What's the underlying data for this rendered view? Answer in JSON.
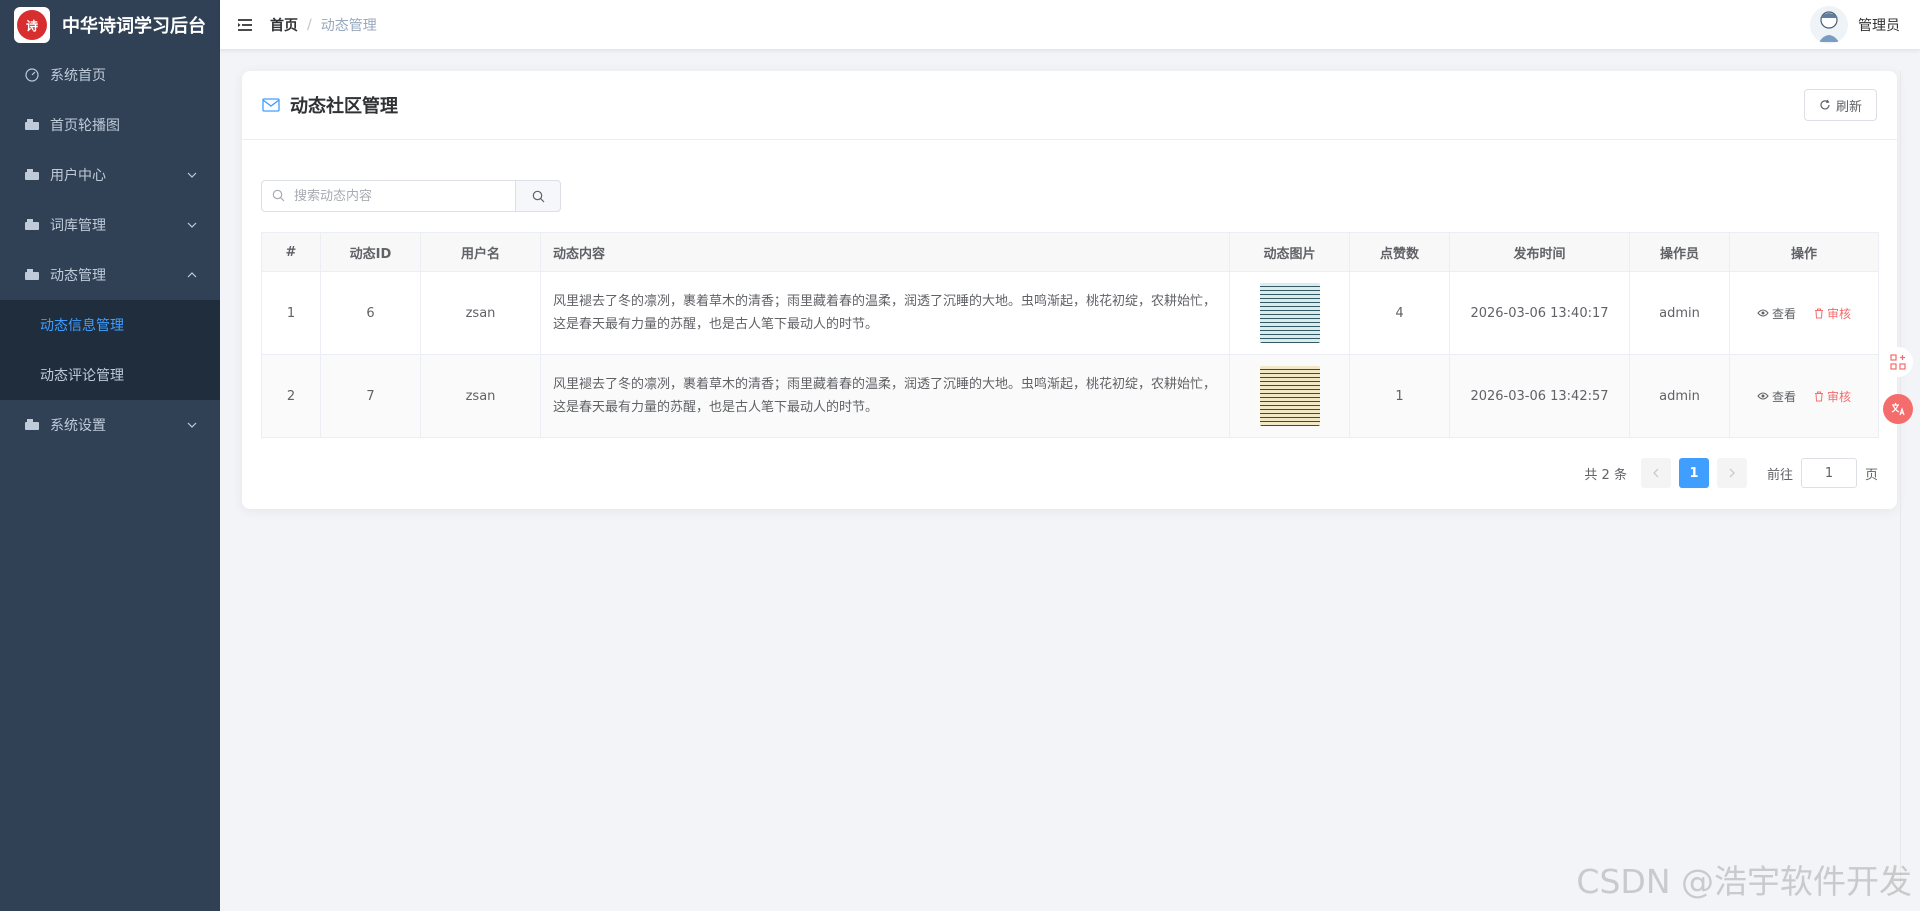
{
  "app": {
    "title": "中华诗词学习后台",
    "logo_text": "诗"
  },
  "sidebar": {
    "items": [
      {
        "label": "系统首页",
        "icon": "dashboard-icon"
      },
      {
        "label": "首页轮播图",
        "icon": "image-icon"
      },
      {
        "label": "用户中心",
        "icon": "user-icon",
        "expandable": true
      },
      {
        "label": "词库管理",
        "icon": "book-icon",
        "expandable": true
      },
      {
        "label": "动态管理",
        "icon": "moment-icon",
        "expandable": true,
        "expanded": true
      },
      {
        "label": "系统设置",
        "icon": "settings-icon",
        "expandable": true
      }
    ],
    "sub_items": [
      {
        "label": "动态信息管理",
        "active": true
      },
      {
        "label": "动态评论管理",
        "active": false
      }
    ]
  },
  "header": {
    "breadcrumb_home": "首页",
    "breadcrumb_sep": "/",
    "breadcrumb_current": "动态管理",
    "user_name": "管理员"
  },
  "card": {
    "title": "动态社区管理",
    "refresh_label": "刷新",
    "search_placeholder": "搜索动态内容"
  },
  "table": {
    "columns": [
      "#",
      "动态ID",
      "用户名",
      "动态内容",
      "动态图片",
      "点赞数",
      "发布时间",
      "操作员",
      "操作"
    ],
    "rows": [
      {
        "index": "1",
        "id": "6",
        "user": "zsan",
        "content": "风里褪去了冬的凛冽，裹着草木的清香；雨里藏着春的温柔，润透了沉睡的大地。虫鸣渐起，桃花初绽，农耕始忙，这是春天最有力量的苏醒，也是古人笔下最动人的时节。",
        "likes": "4",
        "time": "2026-03-06 13:40:17",
        "operator": "admin",
        "view_label": "查看",
        "audit_label": "审核"
      },
      {
        "index": "2",
        "id": "7",
        "user": "zsan",
        "content": "风里褪去了冬的凛冽，裹着草木的清香；雨里藏着春的温柔，润透了沉睡的大地。虫鸣渐起，桃花初绽，农耕始忙，这是春天最有力量的苏醒，也是古人笔下最动人的时节。",
        "likes": "1",
        "time": "2026-03-06 13:42:57",
        "operator": "admin",
        "view_label": "查看",
        "audit_label": "审核"
      }
    ]
  },
  "pagination": {
    "total_text": "共 2 条",
    "current_page": "1",
    "goto_label": "前往",
    "goto_value": "1",
    "page_suffix": "页"
  },
  "watermark": "CSDN @浩宇软件开发",
  "colors": {
    "sidebar_bg": "#304156",
    "submenu_bg": "#1f2d3d",
    "accent": "#409eff",
    "danger": "#f56c6c"
  }
}
